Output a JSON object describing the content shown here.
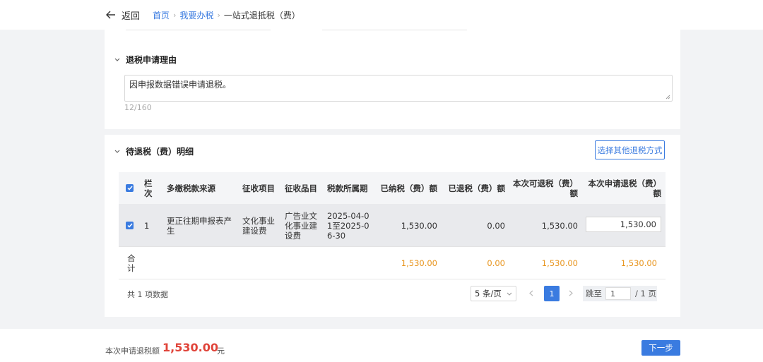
{
  "header": {
    "back_label": "返回",
    "breadcrumb": [
      {
        "label": "首页",
        "link": true
      },
      {
        "label": "我要办税",
        "link": true
      },
      {
        "label": "一站式退抵税（费）",
        "link": false
      }
    ]
  },
  "reason_section": {
    "title": "退税申请理由",
    "reason_text": "因申报数据错误申请退税。",
    "char_count": "12/160"
  },
  "detail_section": {
    "title": "待退税（费）明细",
    "alt_method_button": "选择其他退税方式",
    "columns": {
      "row_no": "栏次",
      "source": "多缴税款来源",
      "item": "征收项目",
      "subitem": "征收品目",
      "period": "税款所属期",
      "paid": "已纳税（费）额",
      "refunded": "已退税（费）额",
      "refundable": "本次可退税（费）额",
      "apply": "本次申请退税（费）额"
    },
    "rows": [
      {
        "row_no": "1",
        "source": "更正往期申报表产生",
        "item": "文化事业建设费",
        "subitem": "广告业文化事业建设费",
        "period": "2025-04-01至2025-06-30",
        "paid": "1,530.00",
        "refunded": "0.00",
        "refundable": "1,530.00",
        "apply": "1,530.00",
        "checked": true
      }
    ],
    "totals": {
      "label": "合计",
      "paid": "1,530.00",
      "refunded": "0.00",
      "refundable": "1,530.00",
      "apply": "1,530.00"
    }
  },
  "pagination": {
    "total_text": "共 1 项数据",
    "page_size": "5 条/页",
    "current_page": "1",
    "jump_label": "跳至",
    "jump_value": "1",
    "total_pages_text": "/ 1 页"
  },
  "footer": {
    "label": "本次申请退税额",
    "amount": "1,530.00",
    "unit": "元",
    "next_button": "下一步"
  },
  "colors": {
    "accent": "#3a7be0",
    "total_orange": "#e8951e",
    "amount_red": "#e0443a"
  }
}
